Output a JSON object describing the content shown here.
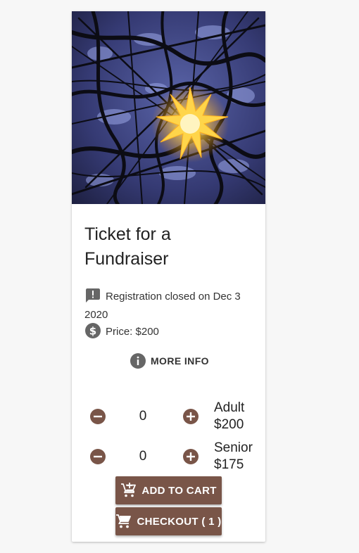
{
  "event": {
    "title": "Ticket for a Fundraiser",
    "registration_status": "Registration closed on Dec 3 2020",
    "price_text": "Price: $200",
    "more_info_label": "MORE INFO"
  },
  "tickets": [
    {
      "quantity": "0",
      "type": "Adult",
      "price": "$200"
    },
    {
      "quantity": "0",
      "type": "Senior",
      "price": "$175"
    }
  ],
  "actions": {
    "add_to_cart_label": "ADD TO CART",
    "checkout_label": "CHECKOUT ( 1 )"
  },
  "colors": {
    "accent": "#795548",
    "icon_gray": "#666666",
    "background": "#f7f7f7",
    "card": "#ffffff"
  },
  "icons": {
    "status": "feedback-exclamation-icon",
    "price": "dollar-circle-icon",
    "info": "info-icon",
    "minus": "minus-circle-icon",
    "plus": "plus-circle-icon",
    "add_cart": "add-shopping-cart-icon",
    "cart": "shopping-cart-icon"
  }
}
